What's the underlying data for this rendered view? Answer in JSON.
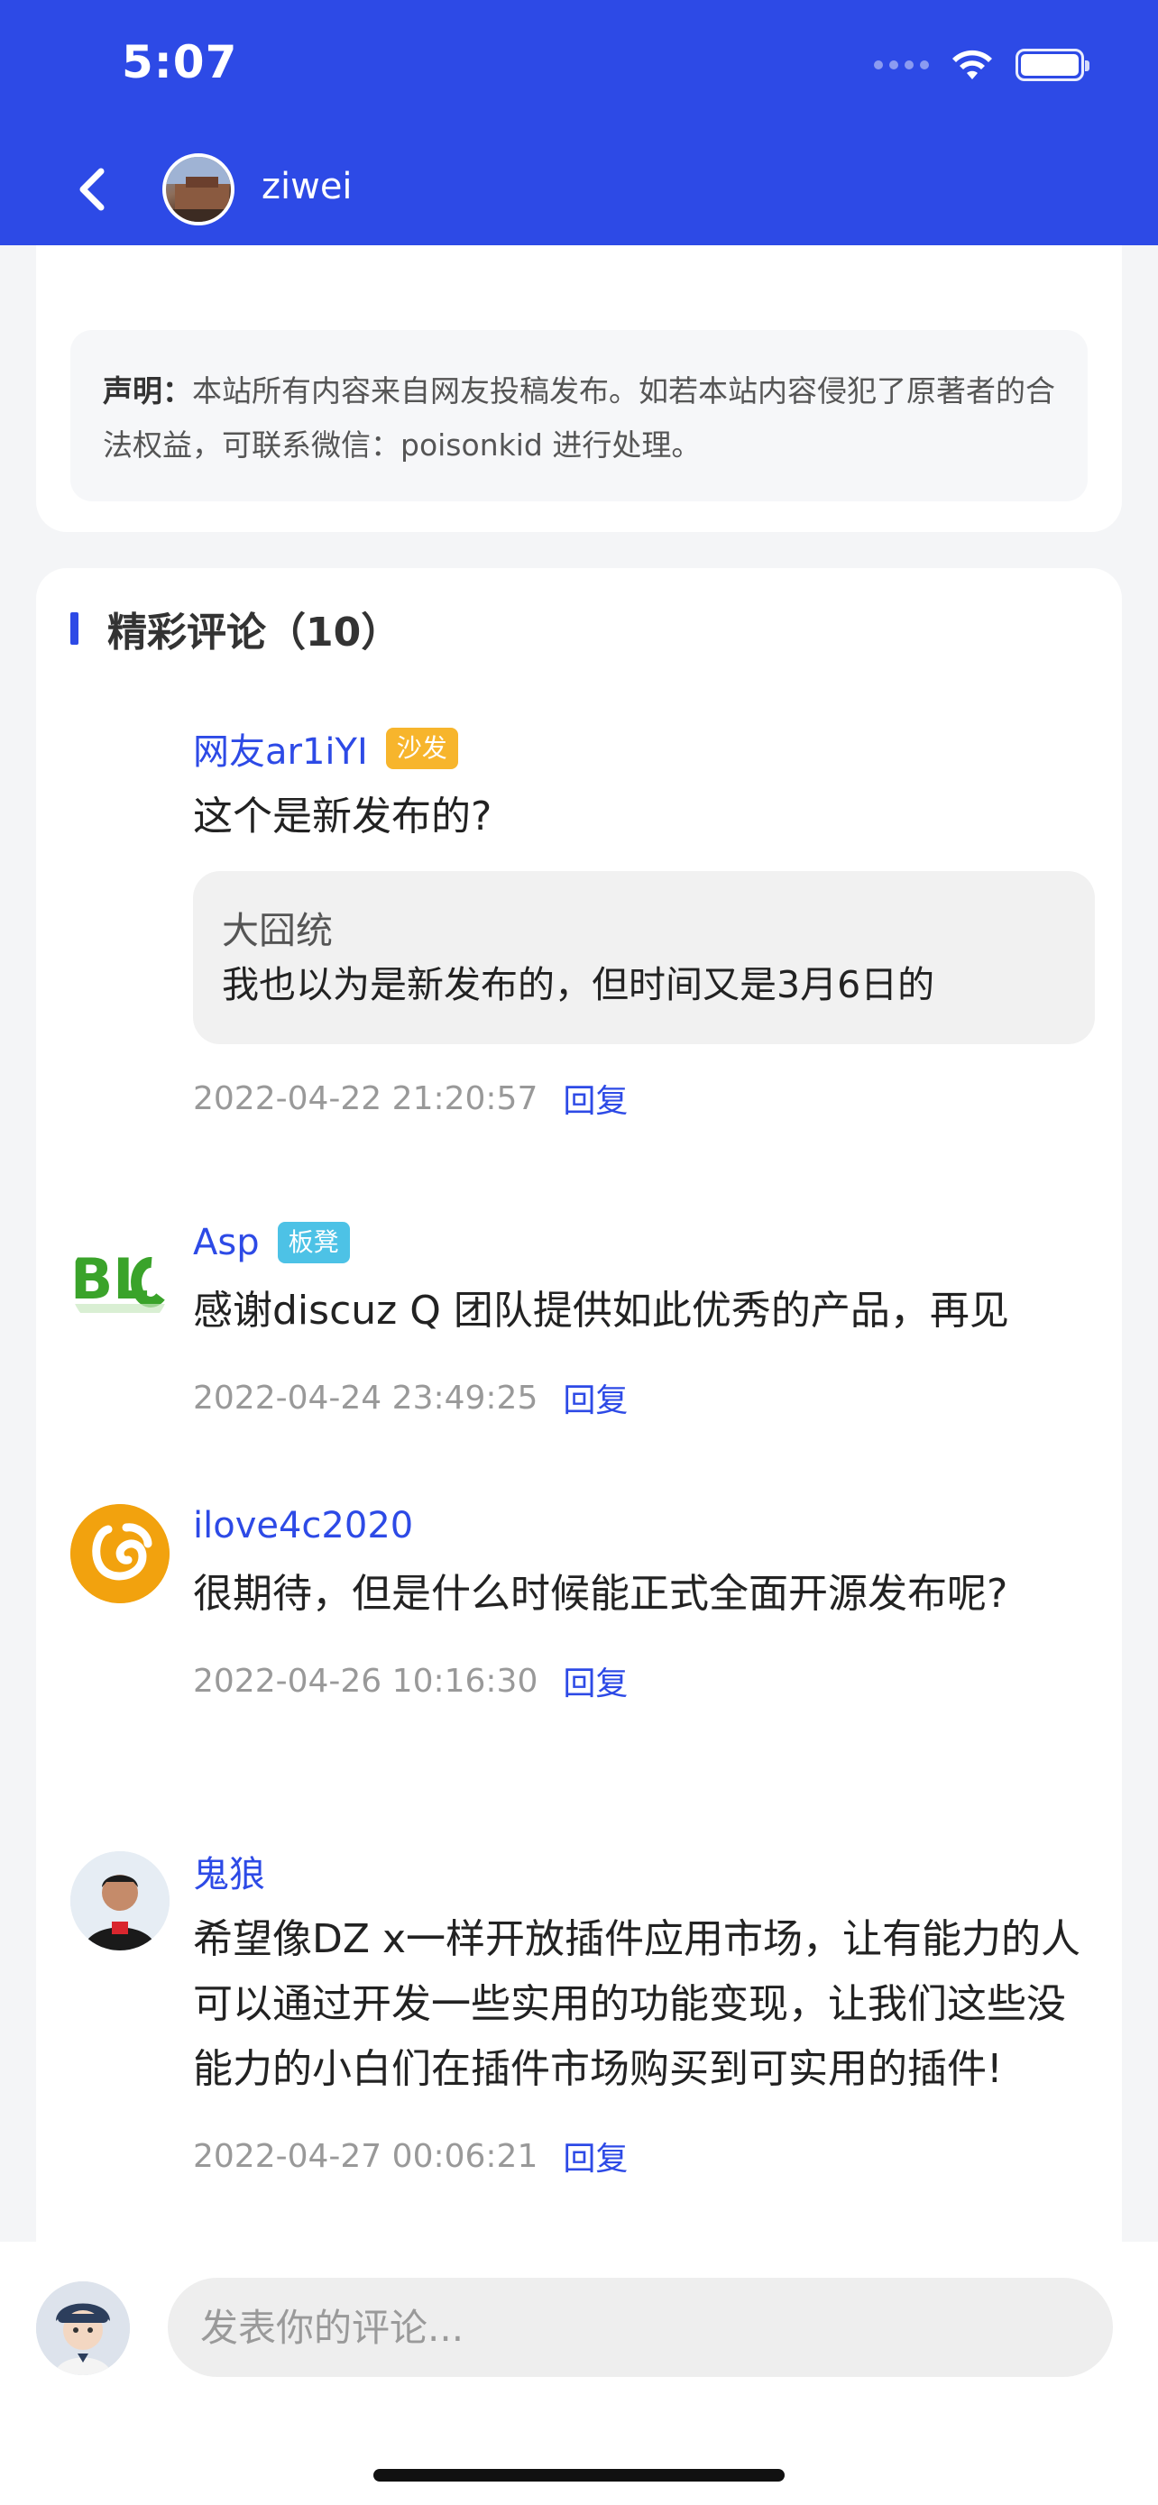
{
  "status_bar": {
    "time": "5:07"
  },
  "header": {
    "username": "ziwei"
  },
  "notice": {
    "label": "声明：",
    "text": "本站所有内容来自网友投稿发布。如若本站内容侵犯了原著者的合法权益，可联系微信：poisonkid 进行处理。"
  },
  "comments_section": {
    "title": "精彩评论（10）",
    "items": [
      {
        "name": "网友ar1iYI",
        "badge": "沙发",
        "text": "这个是新发布的?",
        "quote_author": "大囧统",
        "quote_text": "我也以为是新发布的，但时间又是3月6日的",
        "time": "2022-04-22 21:20:57",
        "reply": "回复"
      },
      {
        "name": "Asp",
        "badge": "板凳",
        "text": "感谢discuz Q 团队提供如此优秀的产品，再见",
        "time": "2022-04-24 23:49:25",
        "reply": "回复"
      },
      {
        "name": "ilove4c2020",
        "text": "很期待，但是什么时候能正式全面开源发布呢?",
        "time": "2022-04-26 10:16:30",
        "reply": "回复"
      },
      {
        "name": "鬼狼",
        "text": "希望像DZ x一样开放插件应用市场，让有能力的人可以通过开发一些实用的功能变现，让我们这些没能力的小白们在插件市场购买到可实用的插件!",
        "time": "2022-04-27 00:06:21",
        "reply": "回复"
      }
    ]
  },
  "input": {
    "placeholder": "发表你的评论..."
  },
  "colors": {
    "primary": "#2d4ae6",
    "sofa_badge": "#f7b52c",
    "bench_badge": "#4dc2e6"
  }
}
